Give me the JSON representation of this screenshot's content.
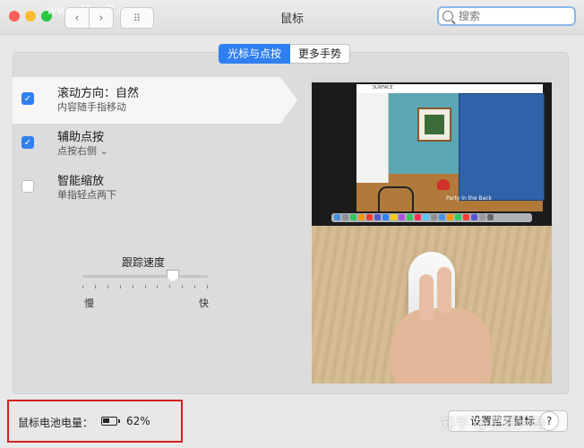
{
  "window": {
    "title": "鼠标"
  },
  "toolbar": {
    "back": "‹",
    "forward": "›",
    "grid": "⠿"
  },
  "search": {
    "placeholder": "搜索"
  },
  "tabs": [
    {
      "label": "光标与点按"
    },
    {
      "label": "更多手势"
    }
  ],
  "options": [
    {
      "title": "滚动方向：自然",
      "subtitle": "内容随手指移动",
      "checked": true
    },
    {
      "title": "辅助点按",
      "subtitle": "点按右侧 ⌄",
      "checked": true
    },
    {
      "title": "智能缩放",
      "subtitle": "单指轻点两下",
      "checked": false
    }
  ],
  "tracking": {
    "label": "跟踪速度",
    "min_label": "慢",
    "max_label": "快",
    "value_fraction": 0.72
  },
  "preview": {
    "site_name": "SURFACE",
    "caption": "Party in the Back"
  },
  "battery": {
    "label": "鼠标电池电量：",
    "value": "62%",
    "level": 0.62
  },
  "bluetooth_button": {
    "label": "设置蓝牙鼠标…"
  },
  "help": {
    "label": "?"
  },
  "watermarks": {
    "top": "www.MacZ.com",
    "bottom": "知乎 @星辰大海"
  },
  "colors": {
    "accent": "#2f7ff0",
    "highlight_box": "#d02020"
  }
}
